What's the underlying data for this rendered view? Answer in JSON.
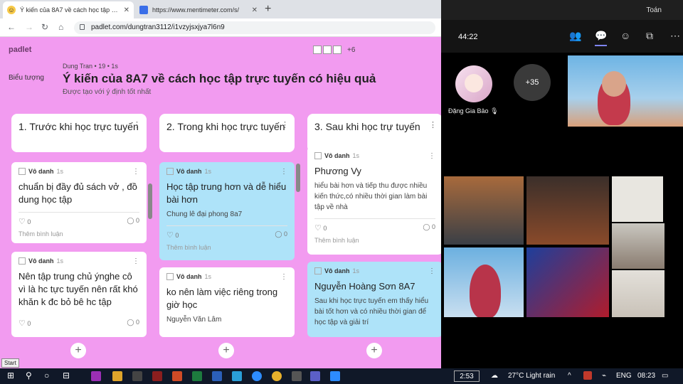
{
  "browser": {
    "tabs": [
      {
        "title": "Ý kiến của 8A7 về cách học tập trực tuyến có hiệu quả",
        "favicon": "padlet-icon"
      },
      {
        "title": "https://www.mentimeter.com/s/",
        "favicon": "mentimeter-icon"
      }
    ],
    "url": "padlet.com/dungtran3112/i1vzyjsxjya7l6n9"
  },
  "padlet": {
    "logo": "padlet",
    "plus_count": "+6",
    "author_name": "Dung Tran",
    "author_meta": "• 19 • 1s",
    "board_icon_alt": "Biểu tượng",
    "title": "Ý kiến của 8A7 về cách học tập trực tuyến có hiệu quả",
    "subtitle": "Được tạo với ý định tốt nhất",
    "columns": [
      {
        "header": "1. Trước khi học trực tuyến",
        "cards": [
          {
            "author": "Vô danh",
            "time": "1s",
            "heading": "chuẩn bị đầy đủ sách vở , đồ dung học tập",
            "body": "",
            "likes": "0",
            "comments": "0",
            "comment_placeholder": "Thêm bình luận",
            "color": "white"
          },
          {
            "author": "Vô danh",
            "time": "1s",
            "heading": "Nên tập trung chủ ýnghe cô vì là hc tực tuyến nên rất khó khăn k đc bỏ bê hc tập",
            "body": "",
            "likes": "0",
            "comments": "0",
            "comment_placeholder": "",
            "color": "white"
          }
        ]
      },
      {
        "header": "2. Trong khi học trực tuyến",
        "cards": [
          {
            "author": "Vô danh",
            "time": "1s",
            "heading": "Học tập trung hơn và dễ hiểu bài hơn",
            "body": "Chung lê đại phong 8a7",
            "likes": "0",
            "comments": "0",
            "comment_placeholder": "Thêm bình luận",
            "color": "blue"
          },
          {
            "author": "Vô danh",
            "time": "1s",
            "heading": "ko nên làm việc riêng trong giờ học",
            "body": "Nguyễn Văn Lâm",
            "likes": "",
            "comments": "",
            "comment_placeholder": "",
            "color": "white"
          }
        ]
      },
      {
        "header": "3. Sau khi học trự tuyến",
        "cards": [
          {
            "author": "Vô danh",
            "time": "1s",
            "heading": "Phương Vy",
            "body": "hiểu bài hơn và tiếp thu được nhiều kiến thức,có nhiều thời gian làm bài tập về nhà",
            "likes": "0",
            "comments": "0",
            "comment_placeholder": "Thêm bình luận",
            "color": "white"
          },
          {
            "author": "Vô danh",
            "time": "1s",
            "heading": "Nguyễn Hoàng Sơn 8A7",
            "body": "Sau khi học trực tuyến em thấy hiểu bài tốt hơn và có nhiều thời gian để học tập và giải trí",
            "likes": "",
            "comments": "",
            "comment_placeholder": "",
            "color": "blue"
          }
        ]
      }
    ],
    "bg_color": "#f29bf0"
  },
  "teams": {
    "user": "Toán",
    "timer": "44:22",
    "participant_name": "Đặng Gia Bảo",
    "more_count": "+35"
  },
  "taskbar": {
    "start_tooltip": "Start",
    "clock": "2:53",
    "weather": "27°C  Light rain",
    "language": "ENG",
    "time": "08:23"
  }
}
